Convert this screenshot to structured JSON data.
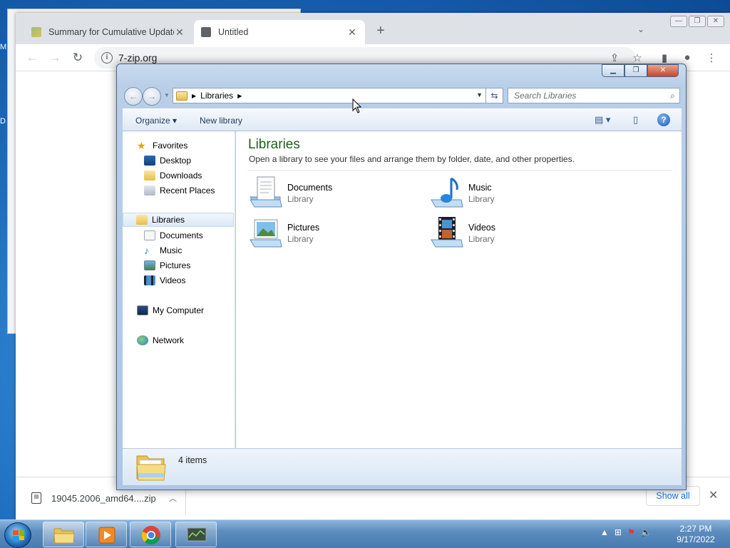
{
  "desktop": {
    "left_labels": [
      "M",
      "D"
    ]
  },
  "browser": {
    "tabs": [
      {
        "title": "Summary for Cumulative Update",
        "active": false
      },
      {
        "title": "Untitled",
        "active": true
      }
    ],
    "new_tab_symbol": "+",
    "url": "7-zip.org",
    "download": {
      "filename": "19045.2006_amd64....zip",
      "show_all": "Show all"
    }
  },
  "explorer": {
    "breadcrumb": "Libraries",
    "search_placeholder": "Search Libraries",
    "commands": {
      "organize": "Organize",
      "new_library": "New library"
    },
    "nav": {
      "favorites": "Favorites",
      "desktop": "Desktop",
      "downloads": "Downloads",
      "recent_places": "Recent Places",
      "libraries": "Libraries",
      "documents": "Documents",
      "music": "Music",
      "pictures": "Pictures",
      "videos": "Videos",
      "my_computer": "My Computer",
      "network": "Network"
    },
    "content": {
      "title": "Libraries",
      "subtitle": "Open a library to see your files and arrange them by folder, date, and other properties.",
      "items": [
        {
          "name": "Documents",
          "type": "Library",
          "icon": "documents-library-icon"
        },
        {
          "name": "Music",
          "type": "Library",
          "icon": "music-library-icon"
        },
        {
          "name": "Pictures",
          "type": "Library",
          "icon": "pictures-library-icon"
        },
        {
          "name": "Videos",
          "type": "Library",
          "icon": "videos-library-icon"
        }
      ]
    },
    "status": "4 items"
  },
  "taskbar": {
    "time": "2:27 PM",
    "date": "9/17/2022"
  },
  "colors": {
    "title_green": "#1e5e1e",
    "link_blue": "#1a73e8",
    "taskbar_blue": "#5d8dbe"
  }
}
